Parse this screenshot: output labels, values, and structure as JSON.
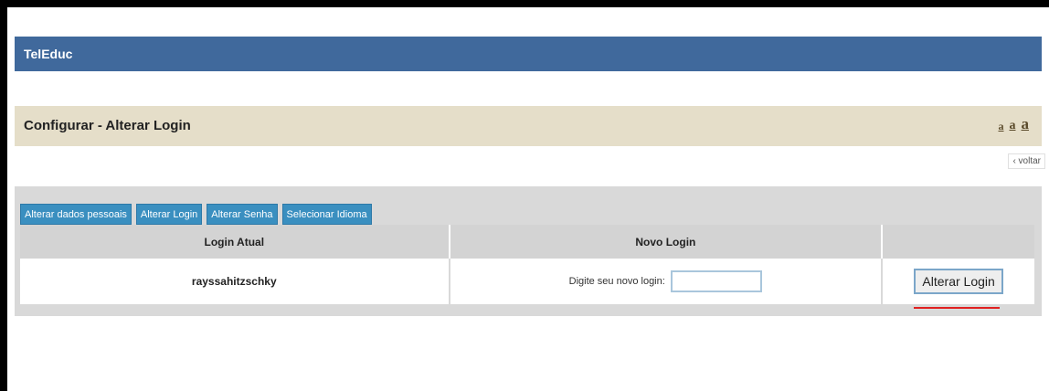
{
  "header": {
    "app_name": "TelEduc"
  },
  "title_bar": {
    "title": "Configurar - Alterar Login",
    "font_size_options": [
      "a",
      "a",
      "a"
    ]
  },
  "back_link": "‹ voltar",
  "tabs": [
    {
      "label": "Alterar dados pessoais"
    },
    {
      "label": "Alterar Login"
    },
    {
      "label": "Alterar Senha"
    },
    {
      "label": "Selecionar Idioma"
    }
  ],
  "table": {
    "columns": [
      "Login Atual",
      "Novo Login",
      ""
    ],
    "current_login": "rayssahitzschky",
    "new_login_label": "Digite seu novo login:",
    "new_login_value": "",
    "submit_label": "Alterar Login"
  },
  "colors": {
    "header_bg": "#40699c",
    "title_bg": "#e5dec9",
    "tab_bg": "#3a8fc0",
    "annotation": "#e02020"
  }
}
